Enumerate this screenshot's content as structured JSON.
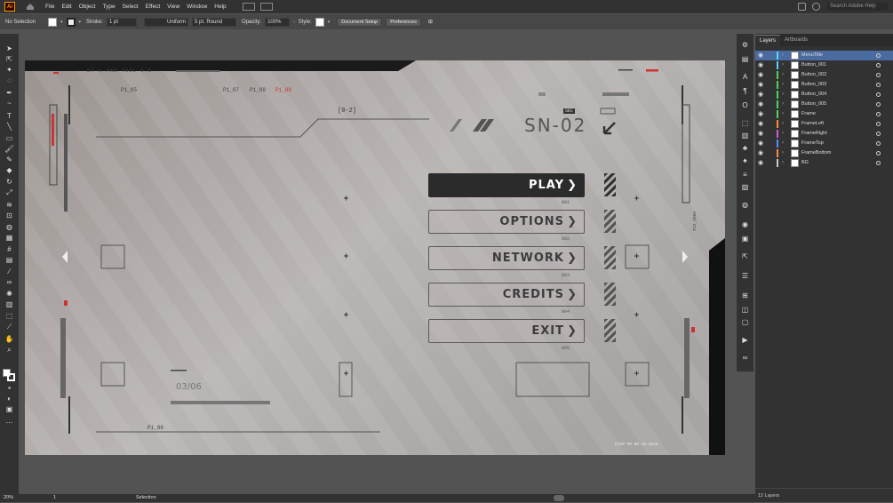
{
  "app": {
    "logo": "Ai"
  },
  "menu": [
    "File",
    "Edit",
    "Object",
    "Type",
    "Select",
    "Effect",
    "View",
    "Window",
    "Help"
  ],
  "search": {
    "placeholder": "Search Adobe Help"
  },
  "control_bar": {
    "selection": "No Selection",
    "stroke_label": "Stroke:",
    "stroke_weight": "1 pt",
    "stroke_profile": "Uniform",
    "brush": "5 pt. Round",
    "opacity_label": "Opacity:",
    "opacity_value": "100%",
    "style_label": "Style:",
    "document_setup": "Document Setup",
    "preferences": "Preferences"
  },
  "artboard": {
    "title": "ST-A PRO TOOL 0.5",
    "tag_bracket": "[0-2]",
    "sec_badge": "SEC",
    "code": "SN-02",
    "page": "03/06",
    "labels": [
      "P1_05",
      "P1_07",
      "P1_08",
      "P1_09",
      "P1_06"
    ],
    "side_label": "FUI_X006",
    "footer_code": "CYAR PR 00-10-2023",
    "buttons": [
      {
        "label": "PLAY",
        "num": "001",
        "active": true
      },
      {
        "label": "OPTIONS",
        "num": "002",
        "active": false
      },
      {
        "label": "NETWORK",
        "num": "003",
        "active": false
      },
      {
        "label": "CREDITS",
        "num": "004",
        "active": false
      },
      {
        "label": "EXIT",
        "num": "005",
        "active": false
      }
    ]
  },
  "layers_panel": {
    "tabs": [
      "Layers",
      "Artboards"
    ],
    "layers": [
      {
        "name": "MenuTitle",
        "color": "#4fd6ff",
        "selected": true
      },
      {
        "name": "Button_001",
        "color": "#4fd6ff",
        "selected": false
      },
      {
        "name": "Button_002",
        "color": "#4fd65a",
        "selected": false
      },
      {
        "name": "Button_003",
        "color": "#4fd65a",
        "selected": false
      },
      {
        "name": "Button_004",
        "color": "#4fd65a",
        "selected": false
      },
      {
        "name": "Button_005",
        "color": "#4fd65a",
        "selected": false
      },
      {
        "name": "Frame",
        "color": "#4fd65a",
        "selected": false
      },
      {
        "name": "FrameLeft",
        "color": "#ff8a3c",
        "selected": false
      },
      {
        "name": "FrameRight",
        "color": "#d05ad0",
        "selected": false
      },
      {
        "name": "FrameTop",
        "color": "#5a8aff",
        "selected": false
      },
      {
        "name": "FrameBottom",
        "color": "#ff8a3c",
        "selected": false
      },
      {
        "name": "BG",
        "color": "#cccccc",
        "selected": false
      }
    ],
    "count": "12 Layers"
  },
  "status": {
    "zoom": "20%",
    "artboard_num": "1",
    "tool": "Selection"
  }
}
